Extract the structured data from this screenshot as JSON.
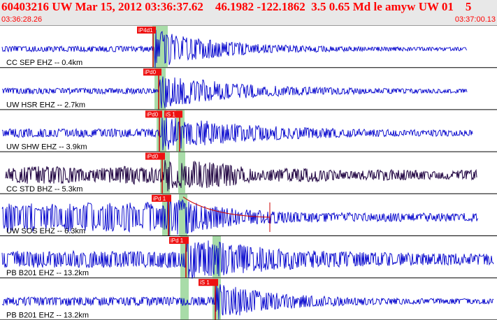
{
  "header": {
    "title": "60403216 UW Mar 15, 2012 03:36:37.62    46.1982 -122.1862  3.5 0.65 Md le amyw UW 01    5",
    "start_time": "03:36:28.26",
    "end_time": "03:37:00.13"
  },
  "colors": {
    "background": "#ffffff",
    "header_bg": "#e8e8e8",
    "title_red": "#ff0000",
    "trace_blue": "#0000cc",
    "trace_dark": "#2a0f4a",
    "pick_bg": "#ee1111",
    "window_green": "#a8dca8",
    "pick_line": "#cc0000"
  },
  "traces": [
    {
      "label": "CC SEP EHZ -- 0.4km",
      "picks": [
        "iP4d1"
      ],
      "color": "blue"
    },
    {
      "label": "UW HSR EHZ -- 2.7km",
      "picks": [
        "iPd0"
      ],
      "color": "blue"
    },
    {
      "label": "UW SHW EHZ -- 3.9km",
      "picks": [
        "iPd0",
        "iS 1"
      ],
      "color": "blue"
    },
    {
      "label": "CC STD BHZ -- 5.3km",
      "picks": [
        "iPd0"
      ],
      "color": "dark"
    },
    {
      "label": "UW SOS EHZ -- 6.3km",
      "picks": [
        "iPd 1"
      ],
      "color": "blue"
    },
    {
      "label": "PB B201 EHZ -- 13.2km",
      "picks": [
        "iPd 1"
      ],
      "color": "blue"
    },
    {
      "label": "PB B201 EHZ -- 13.2km",
      "picks": [
        "iS 1"
      ],
      "color": "blue"
    }
  ]
}
